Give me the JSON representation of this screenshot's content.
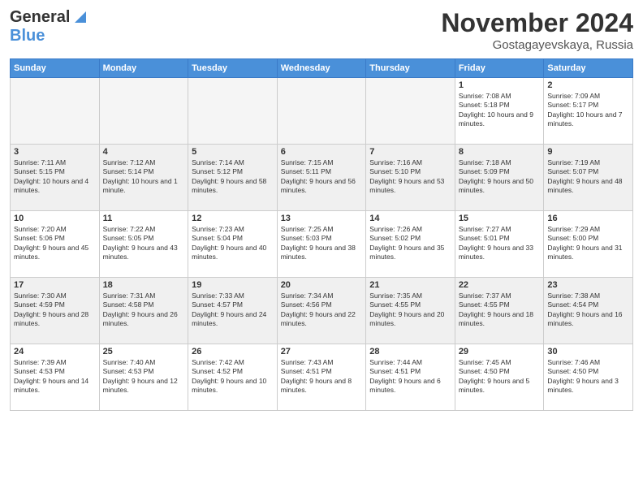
{
  "logo": {
    "line1": "General",
    "line2": "Blue"
  },
  "title": "November 2024",
  "location": "Gostagayevskaya, Russia",
  "days_of_week": [
    "Sunday",
    "Monday",
    "Tuesday",
    "Wednesday",
    "Thursday",
    "Friday",
    "Saturday"
  ],
  "weeks": [
    [
      {
        "day": "",
        "empty": true
      },
      {
        "day": "",
        "empty": true
      },
      {
        "day": "",
        "empty": true
      },
      {
        "day": "",
        "empty": true
      },
      {
        "day": "",
        "empty": true
      },
      {
        "day": "1",
        "info": "Sunrise: 7:08 AM\nSunset: 5:18 PM\nDaylight: 10 hours and 9 minutes."
      },
      {
        "day": "2",
        "info": "Sunrise: 7:09 AM\nSunset: 5:17 PM\nDaylight: 10 hours and 7 minutes."
      }
    ],
    [
      {
        "day": "3",
        "info": "Sunrise: 7:11 AM\nSunset: 5:15 PM\nDaylight: 10 hours and 4 minutes."
      },
      {
        "day": "4",
        "info": "Sunrise: 7:12 AM\nSunset: 5:14 PM\nDaylight: 10 hours and 1 minute."
      },
      {
        "day": "5",
        "info": "Sunrise: 7:14 AM\nSunset: 5:12 PM\nDaylight: 9 hours and 58 minutes."
      },
      {
        "day": "6",
        "info": "Sunrise: 7:15 AM\nSunset: 5:11 PM\nDaylight: 9 hours and 56 minutes."
      },
      {
        "day": "7",
        "info": "Sunrise: 7:16 AM\nSunset: 5:10 PM\nDaylight: 9 hours and 53 minutes."
      },
      {
        "day": "8",
        "info": "Sunrise: 7:18 AM\nSunset: 5:09 PM\nDaylight: 9 hours and 50 minutes."
      },
      {
        "day": "9",
        "info": "Sunrise: 7:19 AM\nSunset: 5:07 PM\nDaylight: 9 hours and 48 minutes."
      }
    ],
    [
      {
        "day": "10",
        "info": "Sunrise: 7:20 AM\nSunset: 5:06 PM\nDaylight: 9 hours and 45 minutes."
      },
      {
        "day": "11",
        "info": "Sunrise: 7:22 AM\nSunset: 5:05 PM\nDaylight: 9 hours and 43 minutes."
      },
      {
        "day": "12",
        "info": "Sunrise: 7:23 AM\nSunset: 5:04 PM\nDaylight: 9 hours and 40 minutes."
      },
      {
        "day": "13",
        "info": "Sunrise: 7:25 AM\nSunset: 5:03 PM\nDaylight: 9 hours and 38 minutes."
      },
      {
        "day": "14",
        "info": "Sunrise: 7:26 AM\nSunset: 5:02 PM\nDaylight: 9 hours and 35 minutes."
      },
      {
        "day": "15",
        "info": "Sunrise: 7:27 AM\nSunset: 5:01 PM\nDaylight: 9 hours and 33 minutes."
      },
      {
        "day": "16",
        "info": "Sunrise: 7:29 AM\nSunset: 5:00 PM\nDaylight: 9 hours and 31 minutes."
      }
    ],
    [
      {
        "day": "17",
        "info": "Sunrise: 7:30 AM\nSunset: 4:59 PM\nDaylight: 9 hours and 28 minutes."
      },
      {
        "day": "18",
        "info": "Sunrise: 7:31 AM\nSunset: 4:58 PM\nDaylight: 9 hours and 26 minutes."
      },
      {
        "day": "19",
        "info": "Sunrise: 7:33 AM\nSunset: 4:57 PM\nDaylight: 9 hours and 24 minutes."
      },
      {
        "day": "20",
        "info": "Sunrise: 7:34 AM\nSunset: 4:56 PM\nDaylight: 9 hours and 22 minutes."
      },
      {
        "day": "21",
        "info": "Sunrise: 7:35 AM\nSunset: 4:55 PM\nDaylight: 9 hours and 20 minutes."
      },
      {
        "day": "22",
        "info": "Sunrise: 7:37 AM\nSunset: 4:55 PM\nDaylight: 9 hours and 18 minutes."
      },
      {
        "day": "23",
        "info": "Sunrise: 7:38 AM\nSunset: 4:54 PM\nDaylight: 9 hours and 16 minutes."
      }
    ],
    [
      {
        "day": "24",
        "info": "Sunrise: 7:39 AM\nSunset: 4:53 PM\nDaylight: 9 hours and 14 minutes."
      },
      {
        "day": "25",
        "info": "Sunrise: 7:40 AM\nSunset: 4:53 PM\nDaylight: 9 hours and 12 minutes."
      },
      {
        "day": "26",
        "info": "Sunrise: 7:42 AM\nSunset: 4:52 PM\nDaylight: 9 hours and 10 minutes."
      },
      {
        "day": "27",
        "info": "Sunrise: 7:43 AM\nSunset: 4:51 PM\nDaylight: 9 hours and 8 minutes."
      },
      {
        "day": "28",
        "info": "Sunrise: 7:44 AM\nSunset: 4:51 PM\nDaylight: 9 hours and 6 minutes."
      },
      {
        "day": "29",
        "info": "Sunrise: 7:45 AM\nSunset: 4:50 PM\nDaylight: 9 hours and 5 minutes."
      },
      {
        "day": "30",
        "info": "Sunrise: 7:46 AM\nSunset: 4:50 PM\nDaylight: 9 hours and 3 minutes."
      }
    ]
  ]
}
